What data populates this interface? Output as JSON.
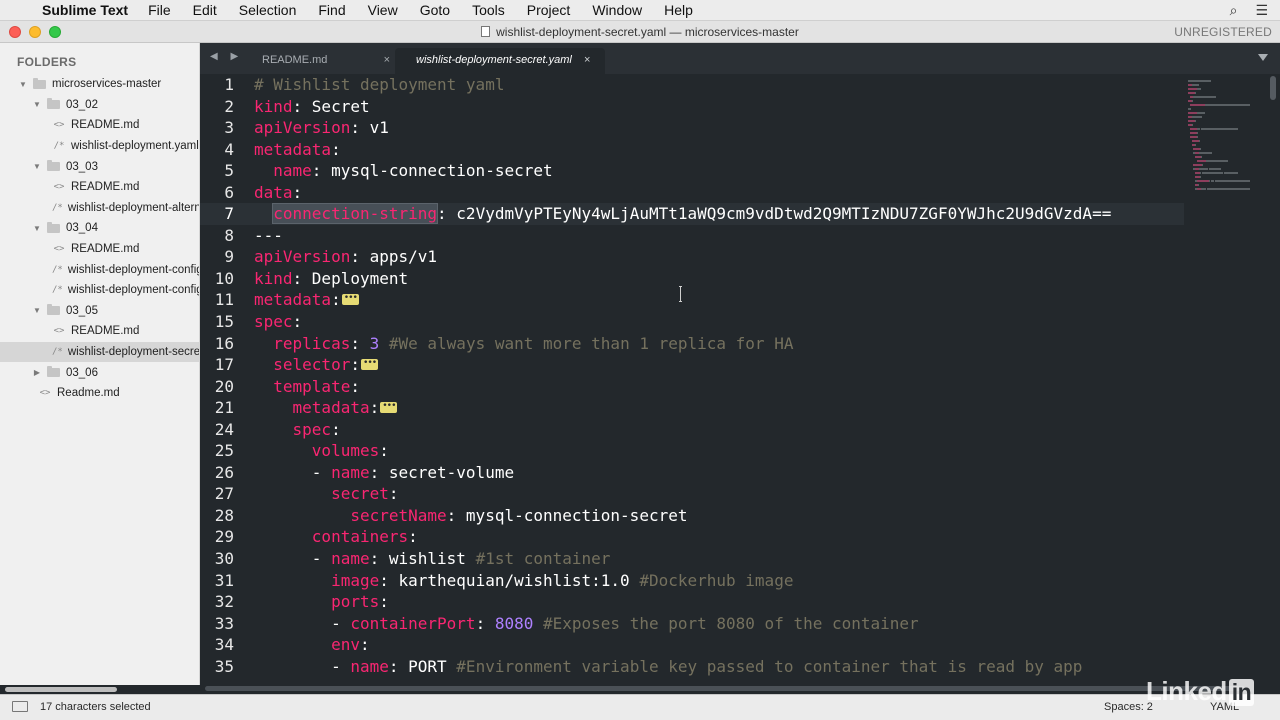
{
  "menubar": {
    "apple": "",
    "app_name": "Sublime Text",
    "items": [
      "File",
      "Edit",
      "Selection",
      "Find",
      "View",
      "Goto",
      "Tools",
      "Project",
      "Window",
      "Help"
    ],
    "search_icon": "⌕",
    "list_icon": "☰"
  },
  "titlebar": {
    "title": "wishlist-deployment-secret.yaml — microservices-master",
    "unregistered": "UNREGISTERED"
  },
  "sidebar": {
    "header": "FOLDERS",
    "rows": [
      {
        "type": "folder",
        "label": "microservices-master",
        "indent": 0,
        "open": true
      },
      {
        "type": "folder",
        "label": "03_02",
        "indent": 1,
        "open": true
      },
      {
        "type": "file",
        "icon": "<>",
        "label": "README.md",
        "indent": 2
      },
      {
        "type": "file",
        "icon": "/*",
        "label": "wishlist-deployment.yaml",
        "indent": 2
      },
      {
        "type": "folder",
        "label": "03_03",
        "indent": 1,
        "open": true
      },
      {
        "type": "file",
        "icon": "<>",
        "label": "README.md",
        "indent": 2
      },
      {
        "type": "file",
        "icon": "/*",
        "label": "wishlist-deployment-alternate.yaml",
        "indent": 2
      },
      {
        "type": "folder",
        "label": "03_04",
        "indent": 1,
        "open": true
      },
      {
        "type": "file",
        "icon": "<>",
        "label": "README.md",
        "indent": 2
      },
      {
        "type": "file",
        "icon": "/*",
        "label": "wishlist-deployment-configmap.yaml",
        "indent": 2
      },
      {
        "type": "file",
        "icon": "/*",
        "label": "wishlist-deployment-configmap-env.yaml",
        "indent": 2
      },
      {
        "type": "folder",
        "label": "03_05",
        "indent": 1,
        "open": true
      },
      {
        "type": "file",
        "icon": "<>",
        "label": "README.md",
        "indent": 2
      },
      {
        "type": "file",
        "icon": "/*",
        "label": "wishlist-deployment-secret.yaml",
        "indent": 2,
        "selected": true
      },
      {
        "type": "folder",
        "label": "03_06",
        "indent": 1,
        "open": false
      },
      {
        "type": "file",
        "icon": "<>",
        "label": "Readme.md",
        "indent": 1
      }
    ]
  },
  "tabs": {
    "nav": "◀ ▶",
    "items": [
      {
        "label": "README.md",
        "close": "×"
      },
      {
        "label": "wishlist-deployment-secret.yaml",
        "close": "×",
        "active": true
      }
    ]
  },
  "editor": {
    "lines": [
      {
        "n": "1",
        "tokens": [
          [
            "c",
            "# Wishlist deployment yaml"
          ]
        ]
      },
      {
        "n": "2",
        "tokens": [
          [
            "k",
            "kind"
          ],
          [
            "p",
            ": "
          ],
          [
            "v",
            "Secret"
          ]
        ]
      },
      {
        "n": "3",
        "tokens": [
          [
            "k",
            "apiVersion"
          ],
          [
            "p",
            ": "
          ],
          [
            "v",
            "v1"
          ]
        ]
      },
      {
        "n": "4",
        "tokens": [
          [
            "k",
            "metadata"
          ],
          [
            "p",
            ":"
          ]
        ]
      },
      {
        "n": "5",
        "tokens": [
          [
            "p",
            "  "
          ],
          [
            "k",
            "name"
          ],
          [
            "p",
            ": "
          ],
          [
            "v",
            "mysql-connection-secret"
          ]
        ]
      },
      {
        "n": "6",
        "tokens": [
          [
            "k",
            "data"
          ],
          [
            "p",
            ":"
          ]
        ]
      },
      {
        "n": "7",
        "current": true,
        "tokens": [
          [
            "p",
            "  "
          ],
          [
            "sel",
            "connection-string"
          ],
          [
            "p",
            ": "
          ],
          [
            "v",
            "c2VydmVyPTEyNy4wLjAuMTt1aWQ9cm9vdDtwd2Q9MTIzNDU7ZGF0YWJhc2U9dGVzdA=="
          ]
        ]
      },
      {
        "n": "8",
        "tokens": [
          [
            "p",
            "---"
          ]
        ]
      },
      {
        "n": "9",
        "tokens": [
          [
            "k",
            "apiVersion"
          ],
          [
            "p",
            ": "
          ],
          [
            "v",
            "apps/v1"
          ]
        ]
      },
      {
        "n": "10",
        "tokens": [
          [
            "k",
            "kind"
          ],
          [
            "p",
            ": "
          ],
          [
            "v",
            "Deployment"
          ]
        ]
      },
      {
        "n": "11",
        "tokens": [
          [
            "k",
            "metadata"
          ],
          [
            "p",
            ":"
          ],
          [
            "fold",
            ""
          ]
        ]
      },
      {
        "n": "15",
        "tokens": [
          [
            "k",
            "spec"
          ],
          [
            "p",
            ":"
          ]
        ]
      },
      {
        "n": "16",
        "tokens": [
          [
            "p",
            "  "
          ],
          [
            "k",
            "replicas"
          ],
          [
            "p",
            ": "
          ],
          [
            "n",
            "3"
          ],
          [
            "p",
            " "
          ],
          [
            "c",
            "#We always want more than 1 replica for HA"
          ]
        ]
      },
      {
        "n": "17",
        "tokens": [
          [
            "p",
            "  "
          ],
          [
            "k",
            "selector"
          ],
          [
            "p",
            ":"
          ],
          [
            "fold",
            ""
          ]
        ]
      },
      {
        "n": "20",
        "tokens": [
          [
            "p",
            "  "
          ],
          [
            "k",
            "template"
          ],
          [
            "p",
            ":"
          ]
        ]
      },
      {
        "n": "21",
        "tokens": [
          [
            "p",
            "    "
          ],
          [
            "k",
            "metadata"
          ],
          [
            "p",
            ":"
          ],
          [
            "fold",
            ""
          ]
        ]
      },
      {
        "n": "24",
        "tokens": [
          [
            "p",
            "    "
          ],
          [
            "k",
            "spec"
          ],
          [
            "p",
            ":"
          ]
        ]
      },
      {
        "n": "25",
        "tokens": [
          [
            "p",
            "      "
          ],
          [
            "k",
            "volumes"
          ],
          [
            "p",
            ":"
          ]
        ]
      },
      {
        "n": "26",
        "tokens": [
          [
            "p",
            "      - "
          ],
          [
            "k",
            "name"
          ],
          [
            "p",
            ": "
          ],
          [
            "v",
            "secret-volume"
          ]
        ]
      },
      {
        "n": "27",
        "tokens": [
          [
            "p",
            "        "
          ],
          [
            "k",
            "secret"
          ],
          [
            "p",
            ":"
          ]
        ]
      },
      {
        "n": "28",
        "tokens": [
          [
            "p",
            "          "
          ],
          [
            "k",
            "secretName"
          ],
          [
            "p",
            ": "
          ],
          [
            "v",
            "mysql-connection-secret"
          ]
        ]
      },
      {
        "n": "29",
        "tokens": [
          [
            "p",
            "      "
          ],
          [
            "k",
            "containers"
          ],
          [
            "p",
            ":"
          ]
        ]
      },
      {
        "n": "30",
        "tokens": [
          [
            "p",
            "      - "
          ],
          [
            "k",
            "name"
          ],
          [
            "p",
            ": "
          ],
          [
            "v",
            "wishlist"
          ],
          [
            "p",
            " "
          ],
          [
            "c",
            "#1st container"
          ]
        ]
      },
      {
        "n": "31",
        "tokens": [
          [
            "p",
            "        "
          ],
          [
            "k",
            "image"
          ],
          [
            "p",
            ": "
          ],
          [
            "v",
            "karthequian/wishlist:1.0"
          ],
          [
            "p",
            " "
          ],
          [
            "c",
            "#Dockerhub image"
          ]
        ]
      },
      {
        "n": "32",
        "tokens": [
          [
            "p",
            "        "
          ],
          [
            "k",
            "ports"
          ],
          [
            "p",
            ":"
          ]
        ]
      },
      {
        "n": "33",
        "tokens": [
          [
            "p",
            "        - "
          ],
          [
            "k",
            "containerPort"
          ],
          [
            "p",
            ": "
          ],
          [
            "n",
            "8080"
          ],
          [
            "p",
            " "
          ],
          [
            "c",
            "#Exposes the port 8080 of the container"
          ]
        ]
      },
      {
        "n": "34",
        "tokens": [
          [
            "p",
            "        "
          ],
          [
            "k",
            "env"
          ],
          [
            "p",
            ":"
          ]
        ]
      },
      {
        "n": "35",
        "tokens": [
          [
            "p",
            "        - "
          ],
          [
            "k",
            "name"
          ],
          [
            "p",
            ": "
          ],
          [
            "v",
            "PORT"
          ],
          [
            "p",
            " "
          ],
          [
            "c",
            "#Environment variable key passed to container that is read by app"
          ]
        ]
      }
    ]
  },
  "statusbar": {
    "selection": "17 characters selected",
    "spaces": "Spaces: 2",
    "syntax": "YAML"
  },
  "watermark": {
    "text": "Linked",
    "box": "in"
  },
  "colors": {
    "editor_bg": "#23282c",
    "key": "#f92672",
    "comment": "#75715e",
    "number": "#ae81ff",
    "fold": "#e6db74"
  }
}
